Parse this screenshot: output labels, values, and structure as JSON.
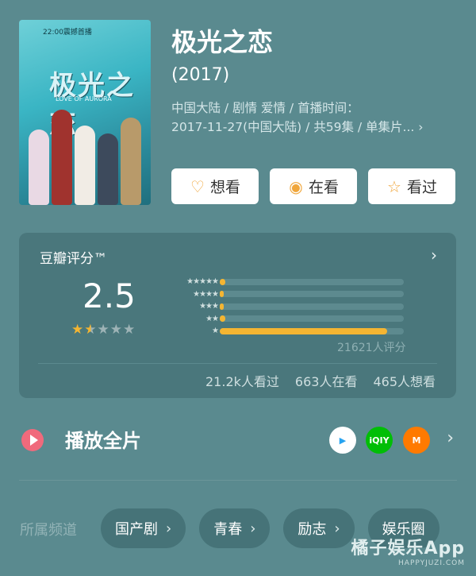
{
  "movie": {
    "title": "极光之恋",
    "year": "(2017)",
    "meta_line1": "中国大陆 / 剧情 爱情 / 首播时间：",
    "meta_line2": "2017-11-27(中国大陆) / 共59集 / 单集片...",
    "poster_title": "极光之恋",
    "poster_subtitle": "LOVE OF AURORA",
    "poster_top": "22:00震撼首播"
  },
  "actions": {
    "want_label": "想看",
    "watching_label": "在看",
    "watched_label": "看过"
  },
  "rating": {
    "title": "豆瓣评分™",
    "score": "2.5",
    "stars_value": 1.5,
    "distribution": [
      {
        "stars": "★★★★★",
        "fraction": 0.03
      },
      {
        "stars": "★★★★",
        "fraction": 0.02
      },
      {
        "stars": "★★★",
        "fraction": 0.02
      },
      {
        "stars": "★★",
        "fraction": 0.03
      },
      {
        "stars": "★",
        "fraction": 0.91
      }
    ],
    "count": "21621人评分",
    "watched": "21.2k人看过",
    "watching": "663人在看",
    "want": "465人想看"
  },
  "play": {
    "label": "播放全片",
    "platforms": [
      {
        "name": "tencent-video",
        "text": "▶",
        "bg": "#ffffff",
        "fg": "#27a3f0"
      },
      {
        "name": "iqiyi",
        "text": "iQIY",
        "bg": "#00be06",
        "fg": "#ffffff"
      },
      {
        "name": "mango-tv",
        "text": "M",
        "bg": "#ff7a00",
        "fg": "#ffffff"
      }
    ]
  },
  "channels": {
    "label": "所属频道",
    "tags": [
      "国产剧",
      "青春",
      "励志",
      "娱乐圈"
    ]
  },
  "watermark": {
    "line1": "橘子娱乐App",
    "line2": "HAPPYJUZI.COM"
  },
  "colors": {
    "accent": "#f4b532",
    "background": "#5a8a8f",
    "card": "#4a777c"
  }
}
